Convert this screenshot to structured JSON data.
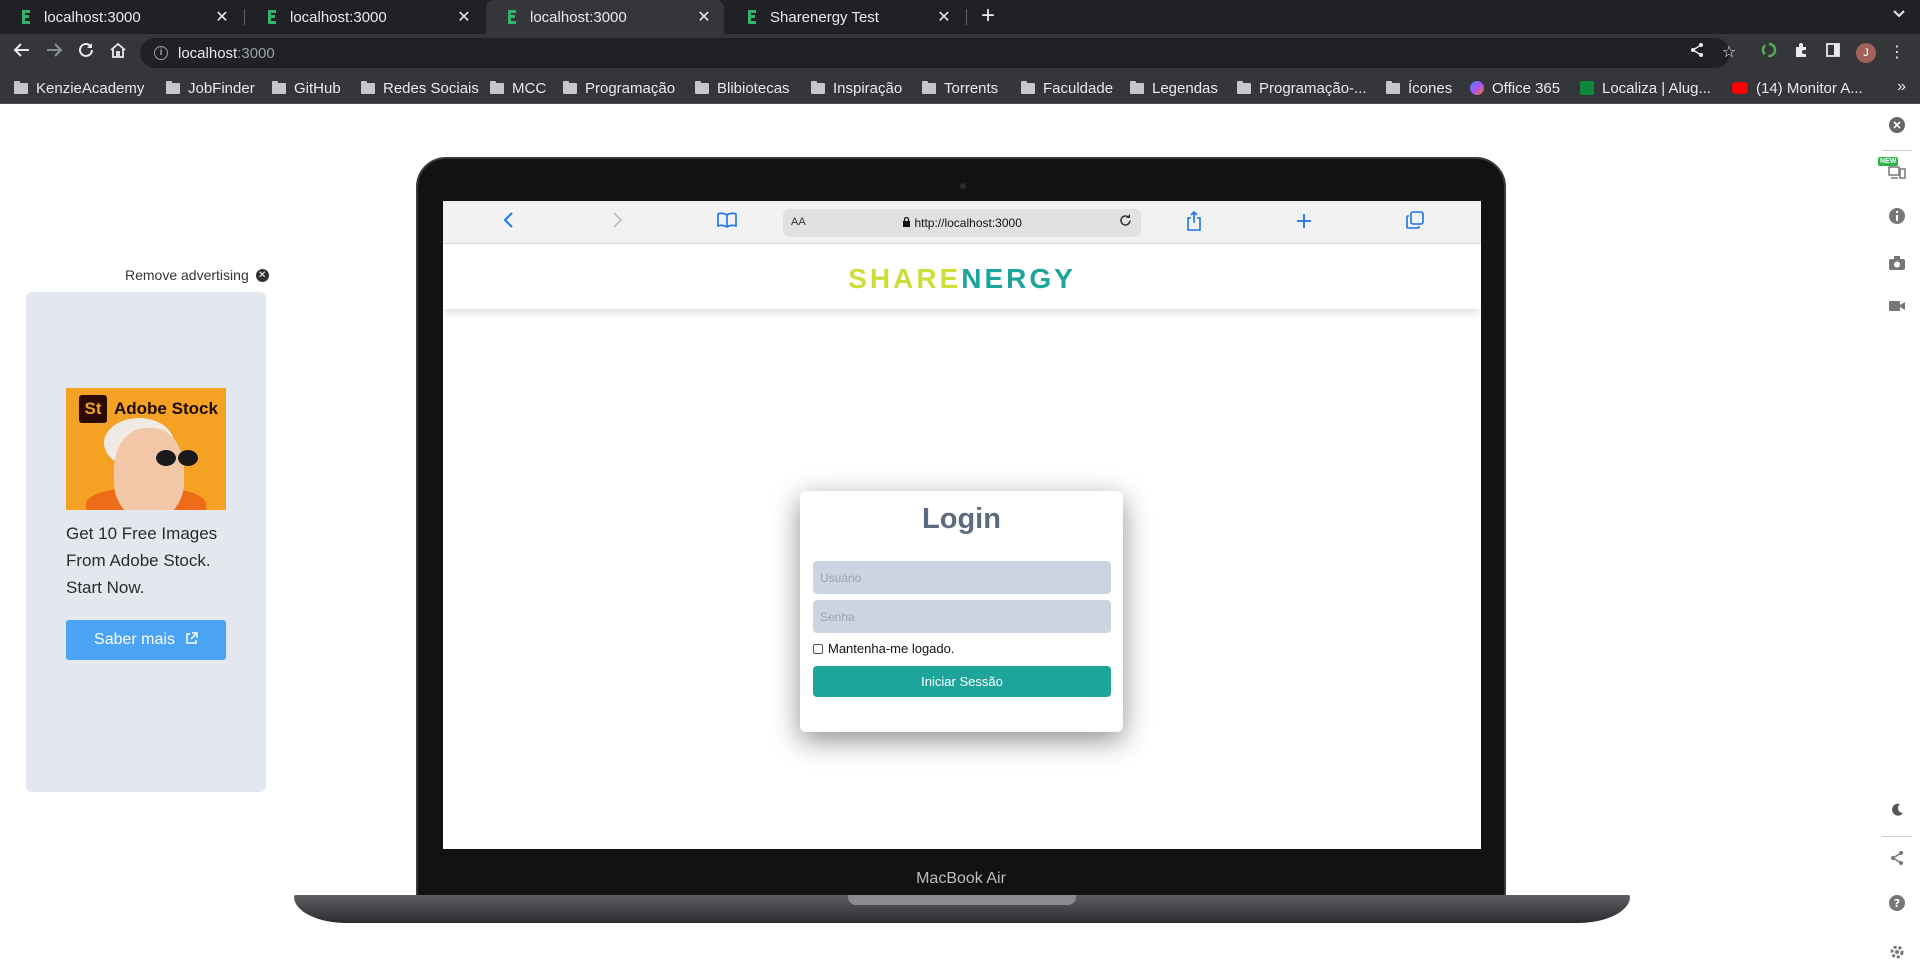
{
  "browser": {
    "tabs": [
      {
        "title": "localhost:3000"
      },
      {
        "title": "localhost:3000"
      },
      {
        "title": "localhost:3000"
      },
      {
        "title": "Sharenergy Test"
      }
    ],
    "active_tab": 2,
    "address": {
      "host": "localhost",
      "port": ":3000"
    },
    "avatar_initial": "J",
    "bookmarks": [
      {
        "label": "KenzieAcademy"
      },
      {
        "label": "JobFinder"
      },
      {
        "label": "GitHub"
      },
      {
        "label": "Redes Sociais"
      },
      {
        "label": "MCC"
      },
      {
        "label": "Programação"
      },
      {
        "label": "Blibiotecas"
      },
      {
        "label": "Inspiração"
      },
      {
        "label": "Torrents"
      },
      {
        "label": "Faculdade"
      },
      {
        "label": "Legendas"
      },
      {
        "label": "Programação-..."
      },
      {
        "label": "Ícones"
      },
      {
        "label": "Office 365"
      },
      {
        "label": "Localiza | Alug..."
      },
      {
        "label": "(14) Monitor A..."
      }
    ]
  },
  "ad": {
    "remove_label": "Remove advertising",
    "image_brand": "Adobe Stock",
    "image_badge": "St",
    "text": "Get 10 Free Images From Adobe Stock. Start Now.",
    "button_label": "Saber mais"
  },
  "sidebar": {
    "new_badge": "NEW"
  },
  "device": {
    "label": "MacBook Air",
    "safari": {
      "aa": "AA",
      "url": "http://localhost:3000"
    },
    "app": {
      "logo_part1": "SHARE",
      "logo_part2": "NERGY",
      "login": {
        "title": "Login",
        "username_placeholder": "Usuário",
        "password_placeholder": "Senha",
        "remember_label": "Mantenha-me logado.",
        "submit_label": "Iniciar Sessão"
      }
    }
  },
  "colors": {
    "brand_teal": "#1ea59b",
    "brand_yellow": "#cddd3a",
    "ad_button": "#4aa3f4"
  }
}
